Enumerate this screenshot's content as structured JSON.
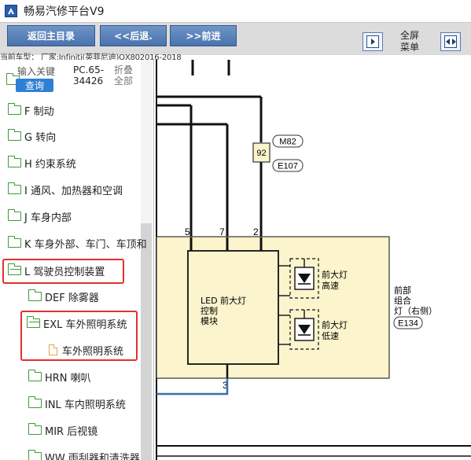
{
  "window": {
    "title": "畅易汽修平台V9"
  },
  "toolbar": {
    "back_home_label": "返回主目录",
    "back_label": "<<后退.",
    "forward_label": ">>前进",
    "fullscreen_label_1": "全屏",
    "fullscreen_label_2": "菜单"
  },
  "vehicle_info": "当前车型： 厂家:Infiniti(英菲尼迪)QX802016-2018",
  "sidebar": {
    "search_hint": "输入关键",
    "search_button": "查询",
    "code_line1": "PC.65-",
    "code_line2": "34426",
    "fold_line1": "折叠",
    "fold_line2": "全部",
    "items": [
      {
        "label": "F 制动"
      },
      {
        "label": "G 转向"
      },
      {
        "label": "H 约束系统"
      },
      {
        "label": "I 通风、加热器和空调"
      },
      {
        "label": "J 车身内部"
      },
      {
        "label": "K 车身外部、车门、车顶和"
      },
      {
        "label": "L 驾驶员控制装置"
      },
      {
        "label": "DEF 除雾器"
      },
      {
        "label": "EXL 车外照明系统"
      },
      {
        "label": "车外照明系统"
      },
      {
        "label": "HRN 喇叭"
      },
      {
        "label": "INL 车内照明系统"
      },
      {
        "label": "MIR 后视镜"
      },
      {
        "label": "WW 雨刮器和清洗器"
      }
    ]
  },
  "diagram": {
    "fuse_label": "92",
    "tag_m82": "M82",
    "tag_e107": "E107",
    "pin_5": "5",
    "pin_7": "7",
    "pin_2": "2",
    "pin_3": "3",
    "module_line1": "LED 前大灯",
    "module_line2": "控制",
    "module_line3": "模块",
    "hi_line1": "前大灯",
    "hi_line2": "高速",
    "lo_line1": "前大灯",
    "lo_line2": "低速",
    "unit_line1": "前部",
    "unit_line2": "组合",
    "unit_line3": "灯（右侧）",
    "unit_code": "E134",
    "colors": {
      "unit_fill": "#fbf4cc",
      "unit_stroke": "#333333",
      "wire": "#111111",
      "wire_blue": "#3a6ea8",
      "highlight": "#e0312f",
      "folder": "#3f9a3a"
    }
  }
}
